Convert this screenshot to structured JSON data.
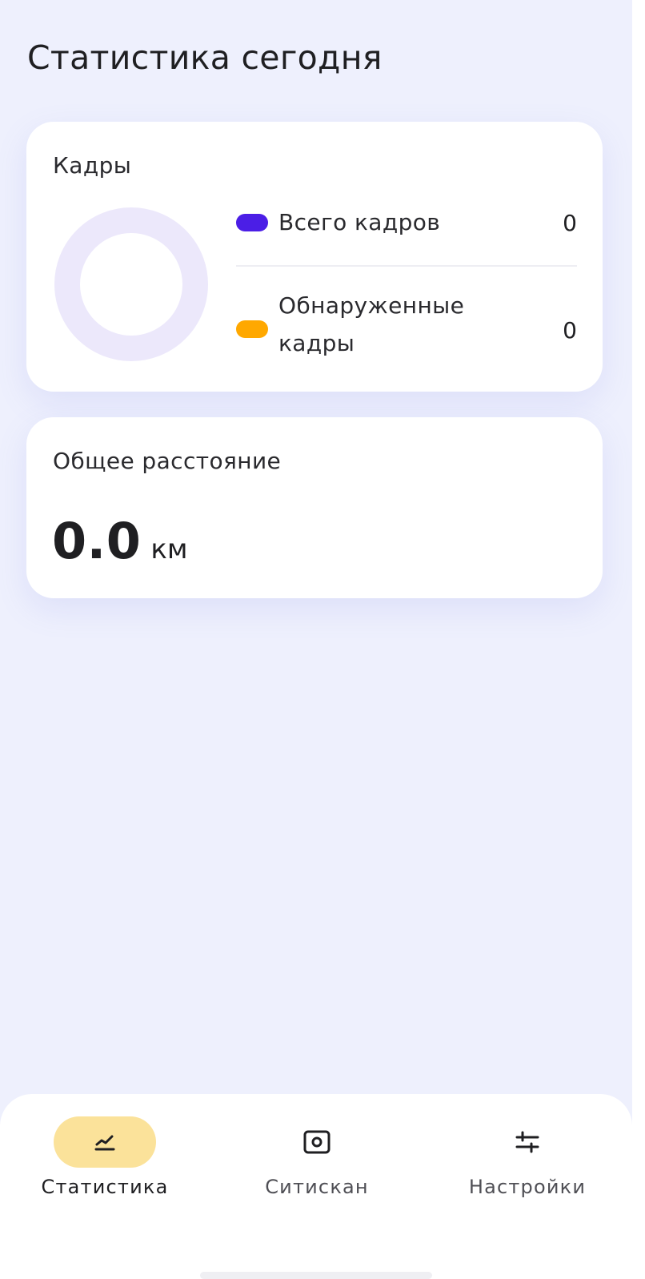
{
  "page": {
    "title": "Статистика сегодня"
  },
  "frames_card": {
    "title": "Кадры",
    "donut": {
      "total": 0,
      "ring_color": "#ece8fb"
    },
    "legend": [
      {
        "label": "Всего кадров",
        "value": "0",
        "color": "#4b1ee6"
      },
      {
        "label": "Обнаруженные кадры",
        "value": "0",
        "color": "#ffa800"
      }
    ]
  },
  "distance_card": {
    "title": "Общее расстояние",
    "value": "0.0",
    "unit": "км"
  },
  "bottom_nav": {
    "active": "stats",
    "items": [
      {
        "id": "stats",
        "label": "Статистика",
        "icon": "chart-line-icon"
      },
      {
        "id": "scan",
        "label": "Ситискан",
        "icon": "camera-icon"
      },
      {
        "id": "settings",
        "label": "Настройки",
        "icon": "sliders-icon"
      }
    ],
    "active_pill_color": "#fbe29a"
  }
}
